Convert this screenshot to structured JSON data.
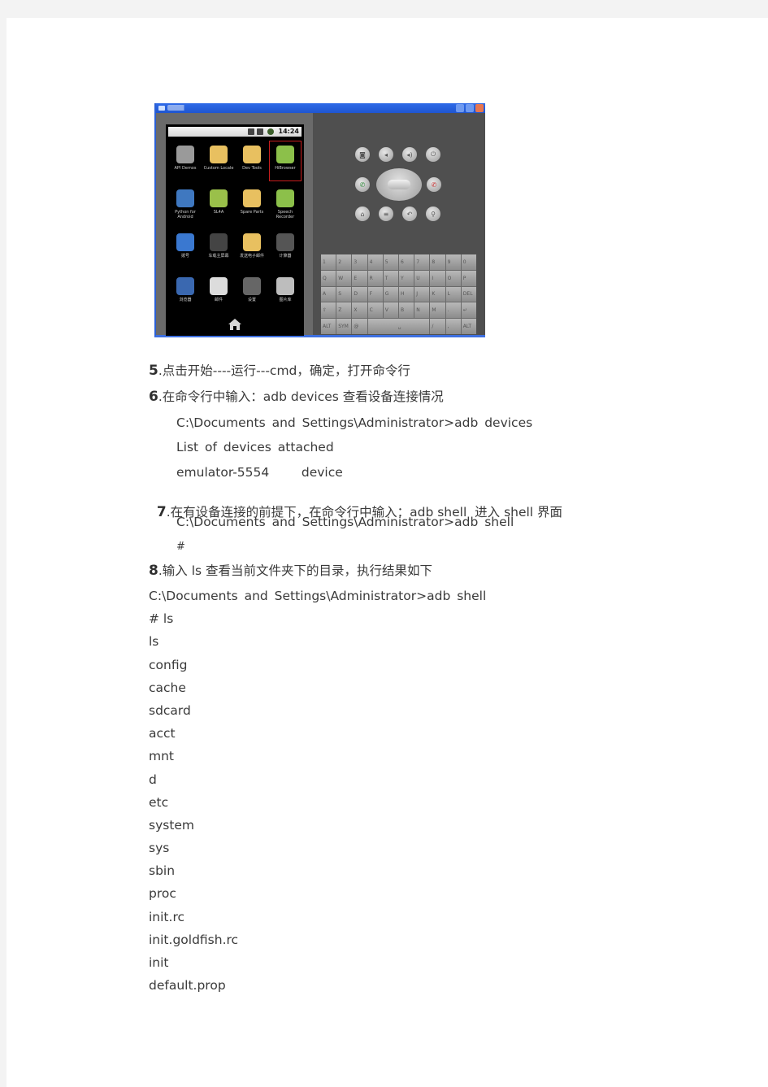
{
  "emulator": {
    "status_time": "14:24",
    "apps": [
      {
        "label": "API Demos",
        "icon": "folder-gear-icon",
        "color": "#9a9a9a"
      },
      {
        "label": "Custom Locale",
        "icon": "gear-flower-icon",
        "color": "#e8c060"
      },
      {
        "label": "Dev Tools",
        "icon": "gear-flower-icon",
        "color": "#e8c060"
      },
      {
        "label": "HiBrowser",
        "icon": "android-app-icon",
        "color": "#8cc04a",
        "selected": true
      },
      {
        "label": "Python for Android",
        "icon": "python-icon",
        "color": "#3f78c0"
      },
      {
        "label": "SL4A",
        "icon": "android-robot-icon",
        "color": "#9ac04a"
      },
      {
        "label": "Spare Parts",
        "icon": "gear-flower-icon",
        "color": "#e8c060"
      },
      {
        "label": "Speech Recorder",
        "icon": "android-app-icon",
        "color": "#8cc04a"
      },
      {
        "label": "拨号",
        "icon": "phone-dialer-icon",
        "color": "#3a78d0"
      },
      {
        "label": "车载主屏幕",
        "icon": "car-home-icon",
        "color": "#444444"
      },
      {
        "label": "发送电子邮件",
        "icon": "email-icon",
        "color": "#e8c060"
      },
      {
        "label": "计算器",
        "icon": "calculator-icon",
        "color": "#555555"
      },
      {
        "label": "浏览器",
        "icon": "globe-icon",
        "color": "#3a68b0"
      },
      {
        "label": "邮件",
        "icon": "mail-icon",
        "color": "#dcdcdc"
      },
      {
        "label": "设置",
        "icon": "settings-icon",
        "color": "#666666"
      },
      {
        "label": "图片库",
        "icon": "gallery-icon",
        "color": "#bdbdbd"
      }
    ],
    "hw_buttons_row1": [
      "camera-button-icon",
      "volume-down-icon",
      "volume-up-icon",
      "power-icon"
    ],
    "hw_buttons_row3": [
      "home-icon",
      "menu-icon",
      "back-icon",
      "search-icon"
    ],
    "keyboard_rows": [
      [
        "1",
        "2",
        "3",
        "4",
        "5",
        "6",
        "7",
        "8",
        "9",
        "0"
      ],
      [
        "Q",
        "W",
        "E",
        "R",
        "T",
        "Y",
        "U",
        "I",
        "O",
        "P"
      ],
      [
        "A",
        "S",
        "D",
        "F",
        "G",
        "H",
        "J",
        "K",
        "L",
        "DEL"
      ],
      [
        "⇧",
        "Z",
        "X",
        "C",
        "V",
        "B",
        "N",
        "M",
        ".",
        "↵"
      ],
      [
        "ALT",
        "SYM",
        "@",
        "␣",
        "/",
        ",",
        "ALT"
      ]
    ]
  },
  "steps": [
    {
      "num": "5",
      "text": ".点击开始----运行---cmd，确定，打开命令行"
    },
    {
      "num": "6",
      "text": ".在命令行中输入：adb devices 查看设备连接情况"
    },
    {
      "num": "7",
      "text": ".在有设备连接的前提下，在命令行中输入：adb shell  进入 shell 界面"
    },
    {
      "num": "8",
      "text": ".输入 ls 查看当前文件夹下的目录，执行结果如下"
    }
  ],
  "step6_output": [
    "C:\\Documents and Settings\\Administrator>adb devices",
    "List of devices attached",
    "emulator-5554     device"
  ],
  "step7_output": [
    "C:\\Documents and Settings\\Administrator>adb shell",
    "#"
  ],
  "step8_output": [
    "C:\\Documents and Settings\\Administrator>adb shell",
    "# ls",
    "ls",
    "config",
    "cache",
    "sdcard",
    "acct",
    "mnt",
    "d",
    "etc",
    "system",
    "sys",
    "sbin",
    "proc",
    "init.rc",
    "init.goldfish.rc",
    "init",
    "default.prop"
  ]
}
